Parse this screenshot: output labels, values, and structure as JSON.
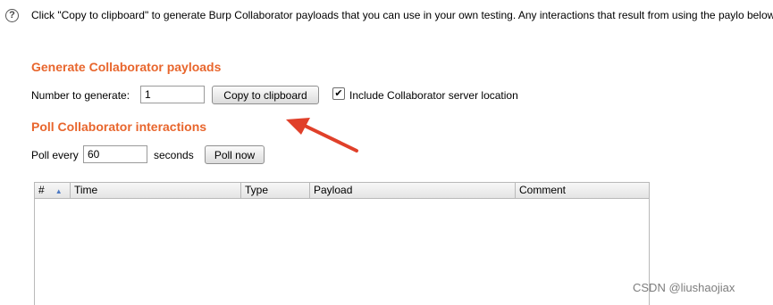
{
  "intro_text": "Click \"Copy to clipboard\" to generate Burp Collaborator payloads that you can use in your own testing. Any interactions that result from using the paylo below.",
  "generate": {
    "title": "Generate Collaborator payloads",
    "number_label": "Number to generate:",
    "number_value": "1",
    "copy_button": "Copy to clipboard",
    "include_checked": true,
    "include_label": "Include Collaborator server location"
  },
  "poll": {
    "title": "Poll Collaborator interactions",
    "poll_every_label": "Poll every",
    "poll_value": "60",
    "seconds_label": "seconds",
    "poll_now_button": "Poll now"
  },
  "table": {
    "columns": [
      "#",
      "Time",
      "Type",
      "Payload",
      "Comment"
    ],
    "rows": []
  },
  "watermark": "CSDN @liushaojiax",
  "colors": {
    "accent": "#e8662d",
    "arrow": "#e0402a"
  }
}
